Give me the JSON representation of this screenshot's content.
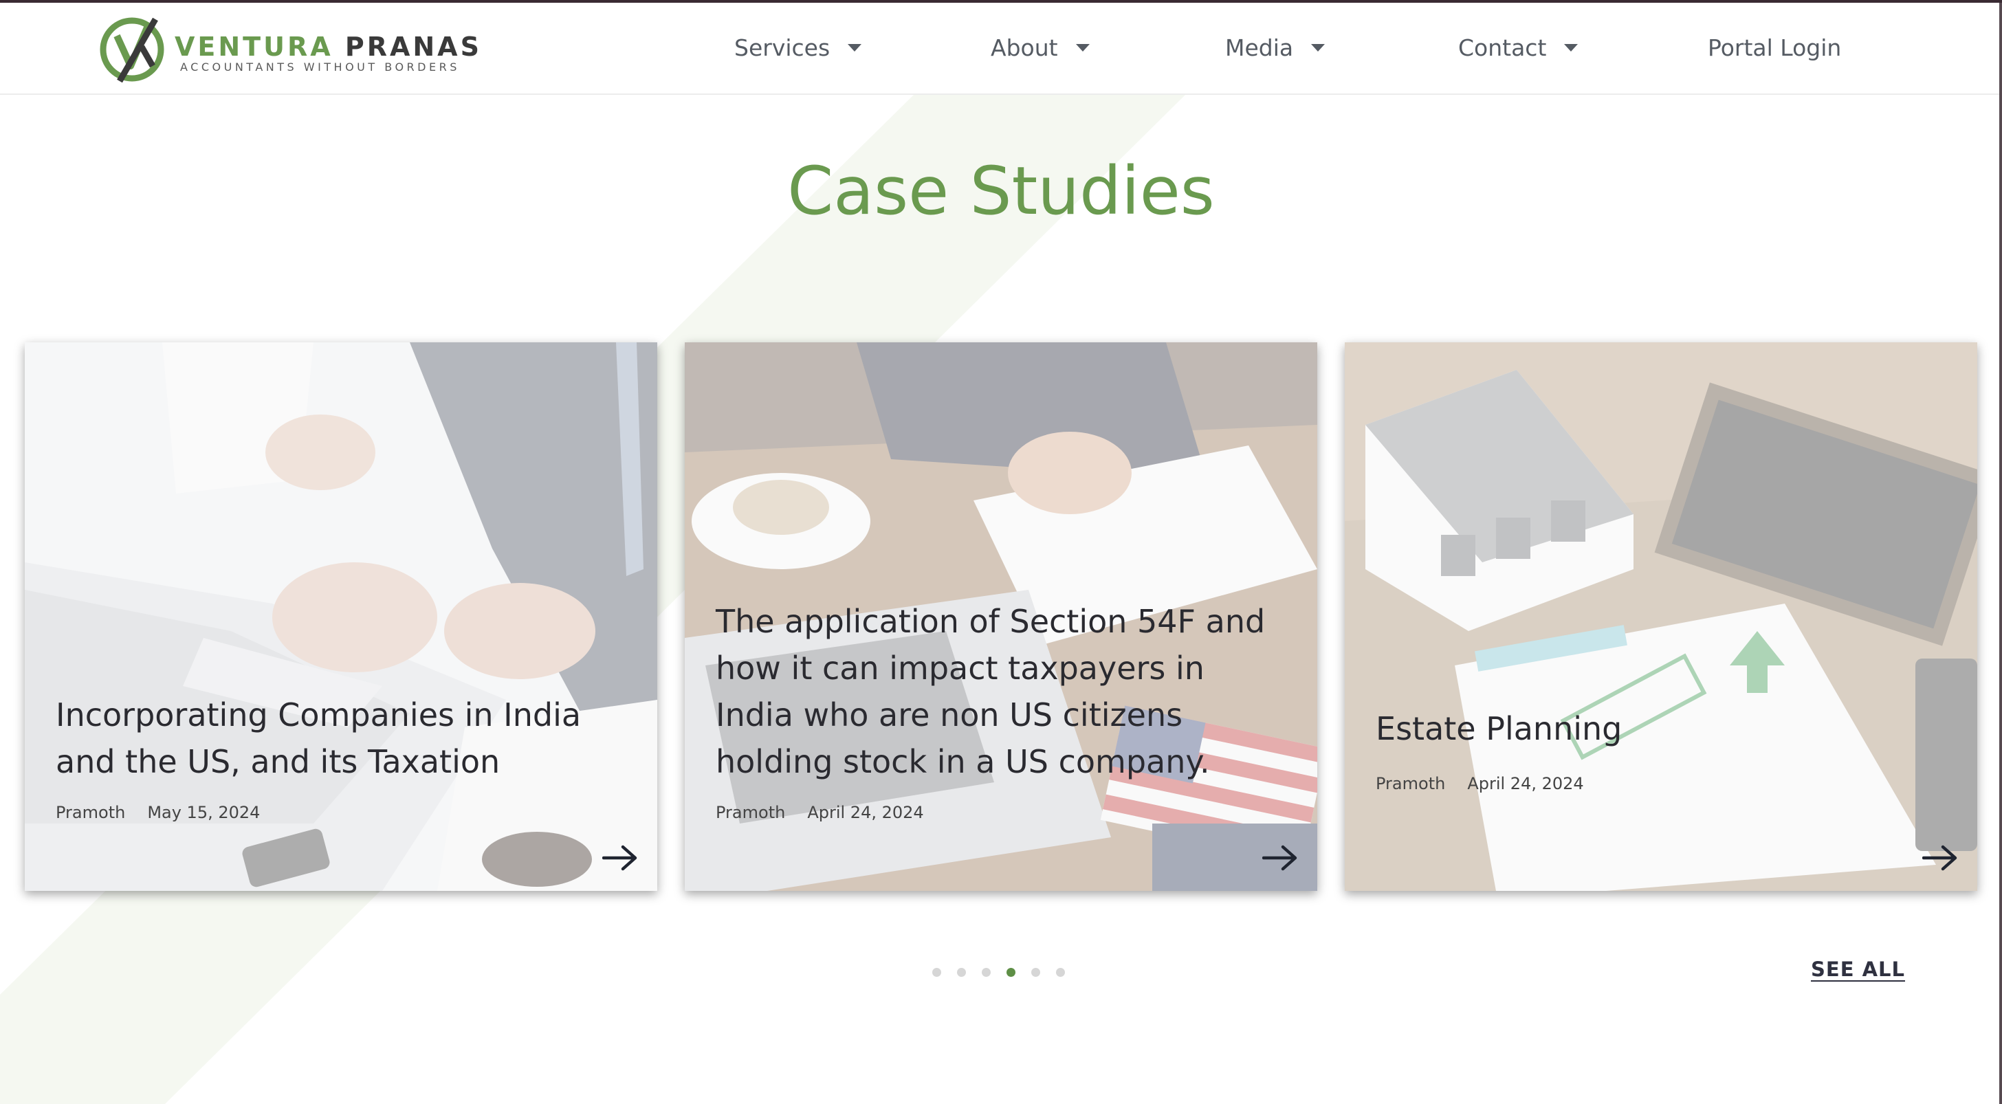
{
  "brand": {
    "name_part1": "VENTURA",
    "name_part2": "PRANAS",
    "tagline": "ACCOUNTANTS WITHOUT BORDERS",
    "logo_icon": "va-monogram-icon"
  },
  "nav": {
    "items": [
      {
        "label": "Services",
        "has_dropdown": true
      },
      {
        "label": "About",
        "has_dropdown": true
      },
      {
        "label": "Media",
        "has_dropdown": true
      },
      {
        "label": "Contact",
        "has_dropdown": true
      },
      {
        "label": "Portal Login",
        "has_dropdown": false
      }
    ]
  },
  "section": {
    "title": "Case Studies"
  },
  "cards": [
    {
      "title": "Incorporating Companies in India and the US, and its Taxation",
      "author": "Pramoth",
      "date": "May 15, 2024",
      "image": "laptop-paperwork-photo"
    },
    {
      "title": "The application of Section 54F and how it can impact taxpayers in India who are non US citizens holding stock in a US company.",
      "author": "Pramoth",
      "date": "April 24, 2024",
      "image": "desk-coffee-us-flag-photo"
    },
    {
      "title": "Estate Planning",
      "author": "Pramoth",
      "date": "April 24, 2024",
      "image": "house-model-mortgage-photo"
    }
  ],
  "carousel": {
    "dot_count": 6,
    "active_index": 3
  },
  "see_all_label": "SEE ALL",
  "colors": {
    "brand_green": "#6a9a4f",
    "active_dot": "#5e8f46",
    "nav_text": "#555b63"
  }
}
